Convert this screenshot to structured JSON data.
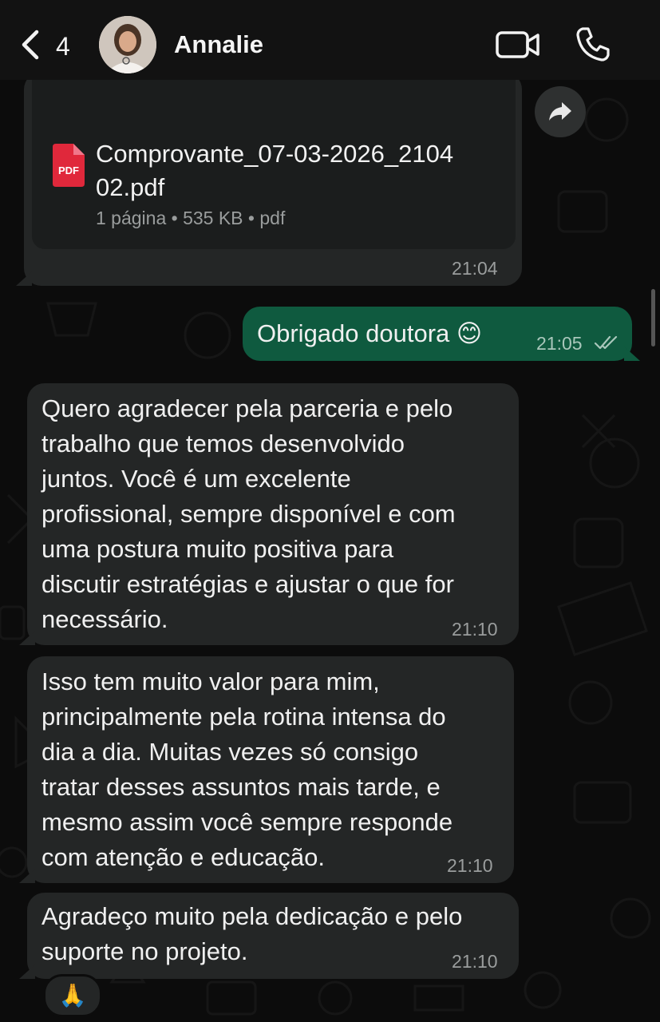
{
  "header": {
    "back_count": "4",
    "contact_name": "Annalie"
  },
  "messages": {
    "document": {
      "file_name": "Comprovante_07-03-2026_2104\n02.pdf",
      "meta": "1 página • 535 KB • pdf",
      "time": "21:04",
      "icon_label": "PDF"
    },
    "outgoing_1": {
      "text": "Obrigado doutora 😊",
      "time": "21:05"
    },
    "incoming_1": {
      "text": "Quero agradecer pela parceria e pelo\ntrabalho que temos desenvolvido\njuntos. Você é um excelente\nprofissional, sempre disponível e com\numa postura muito positiva para\ndiscutir estratégias e ajustar o que for\nnecessário.",
      "time": "21:10"
    },
    "incoming_2": {
      "text": "Isso tem muito valor para mim,\nprincipalmente pela rotina intensa do\ndia a dia. Muitas vezes só consigo\ntratar desses assuntos mais tarde, e\nmesmo assim você sempre responde\ncom atenção e educação.",
      "time": "21:10"
    },
    "incoming_3": {
      "text": "Agradeço muito pela dedicação e pelo\nsuporte no projeto.",
      "time": "21:10",
      "reaction": "🙏"
    }
  },
  "icons": {
    "back": "chevron-left-icon",
    "video": "video-camera-icon",
    "phone": "phone-icon",
    "forward": "forward-arrow-icon",
    "read_receipt": "double-check-icon",
    "pdf": "pdf-file-icon"
  },
  "colors": {
    "background": "#0c0c0c",
    "incoming_bubble": "#242626",
    "outgoing_bubble": "#0f5a3f",
    "pdf_red": "#e0283b"
  }
}
